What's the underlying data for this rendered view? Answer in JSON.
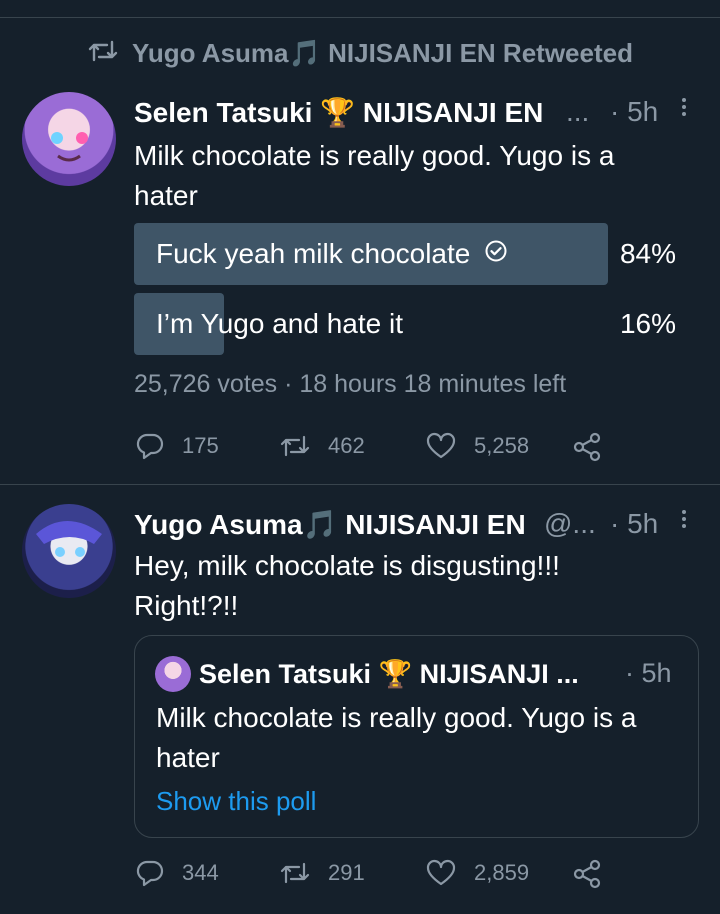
{
  "colors": {
    "background": "#15202b",
    "text": "#ffffff",
    "muted": "#8b98a5",
    "link": "#1d9bf0",
    "poll_bar": "#3f5567",
    "divider": "#38444d"
  },
  "retweet": {
    "text": "Yugo Asuma🎵 NIJISANJI EN Retweeted",
    "icon": "retweet-icon"
  },
  "tweet1": {
    "name": "Selen Tatsuki 🏆 NIJISANJI EN",
    "handle_ellipsis": "...",
    "time": "· 5h",
    "text": "Milk chocolate is really good. Yugo is a hater",
    "poll": {
      "options": [
        {
          "label": "Fuck yeah milk chocolate",
          "percent_text": "84%",
          "percent": 84,
          "winner": true
        },
        {
          "label": "I’m Yugo and hate it",
          "percent_text": "16%",
          "percent": 16,
          "winner": false
        }
      ],
      "meta": "25,726 votes · 18 hours 18 minutes left"
    },
    "actions": {
      "replies": "175",
      "retweets": "462",
      "likes": "5,258"
    }
  },
  "tweet2": {
    "name": "Yugo Asuma🎵 NIJISANJI EN",
    "handle": "@...",
    "time": "· 5h",
    "text": "Hey, milk chocolate is disgusting!!! Right!?!!",
    "quote": {
      "name": "Selen Tatsuki 🏆 NIJISANJI ...",
      "time": "· 5h",
      "text": "Milk chocolate is really good. Yugo is a hater",
      "link": "Show this poll"
    },
    "actions": {
      "replies": "344",
      "retweets": "291",
      "likes": "2,859"
    }
  }
}
